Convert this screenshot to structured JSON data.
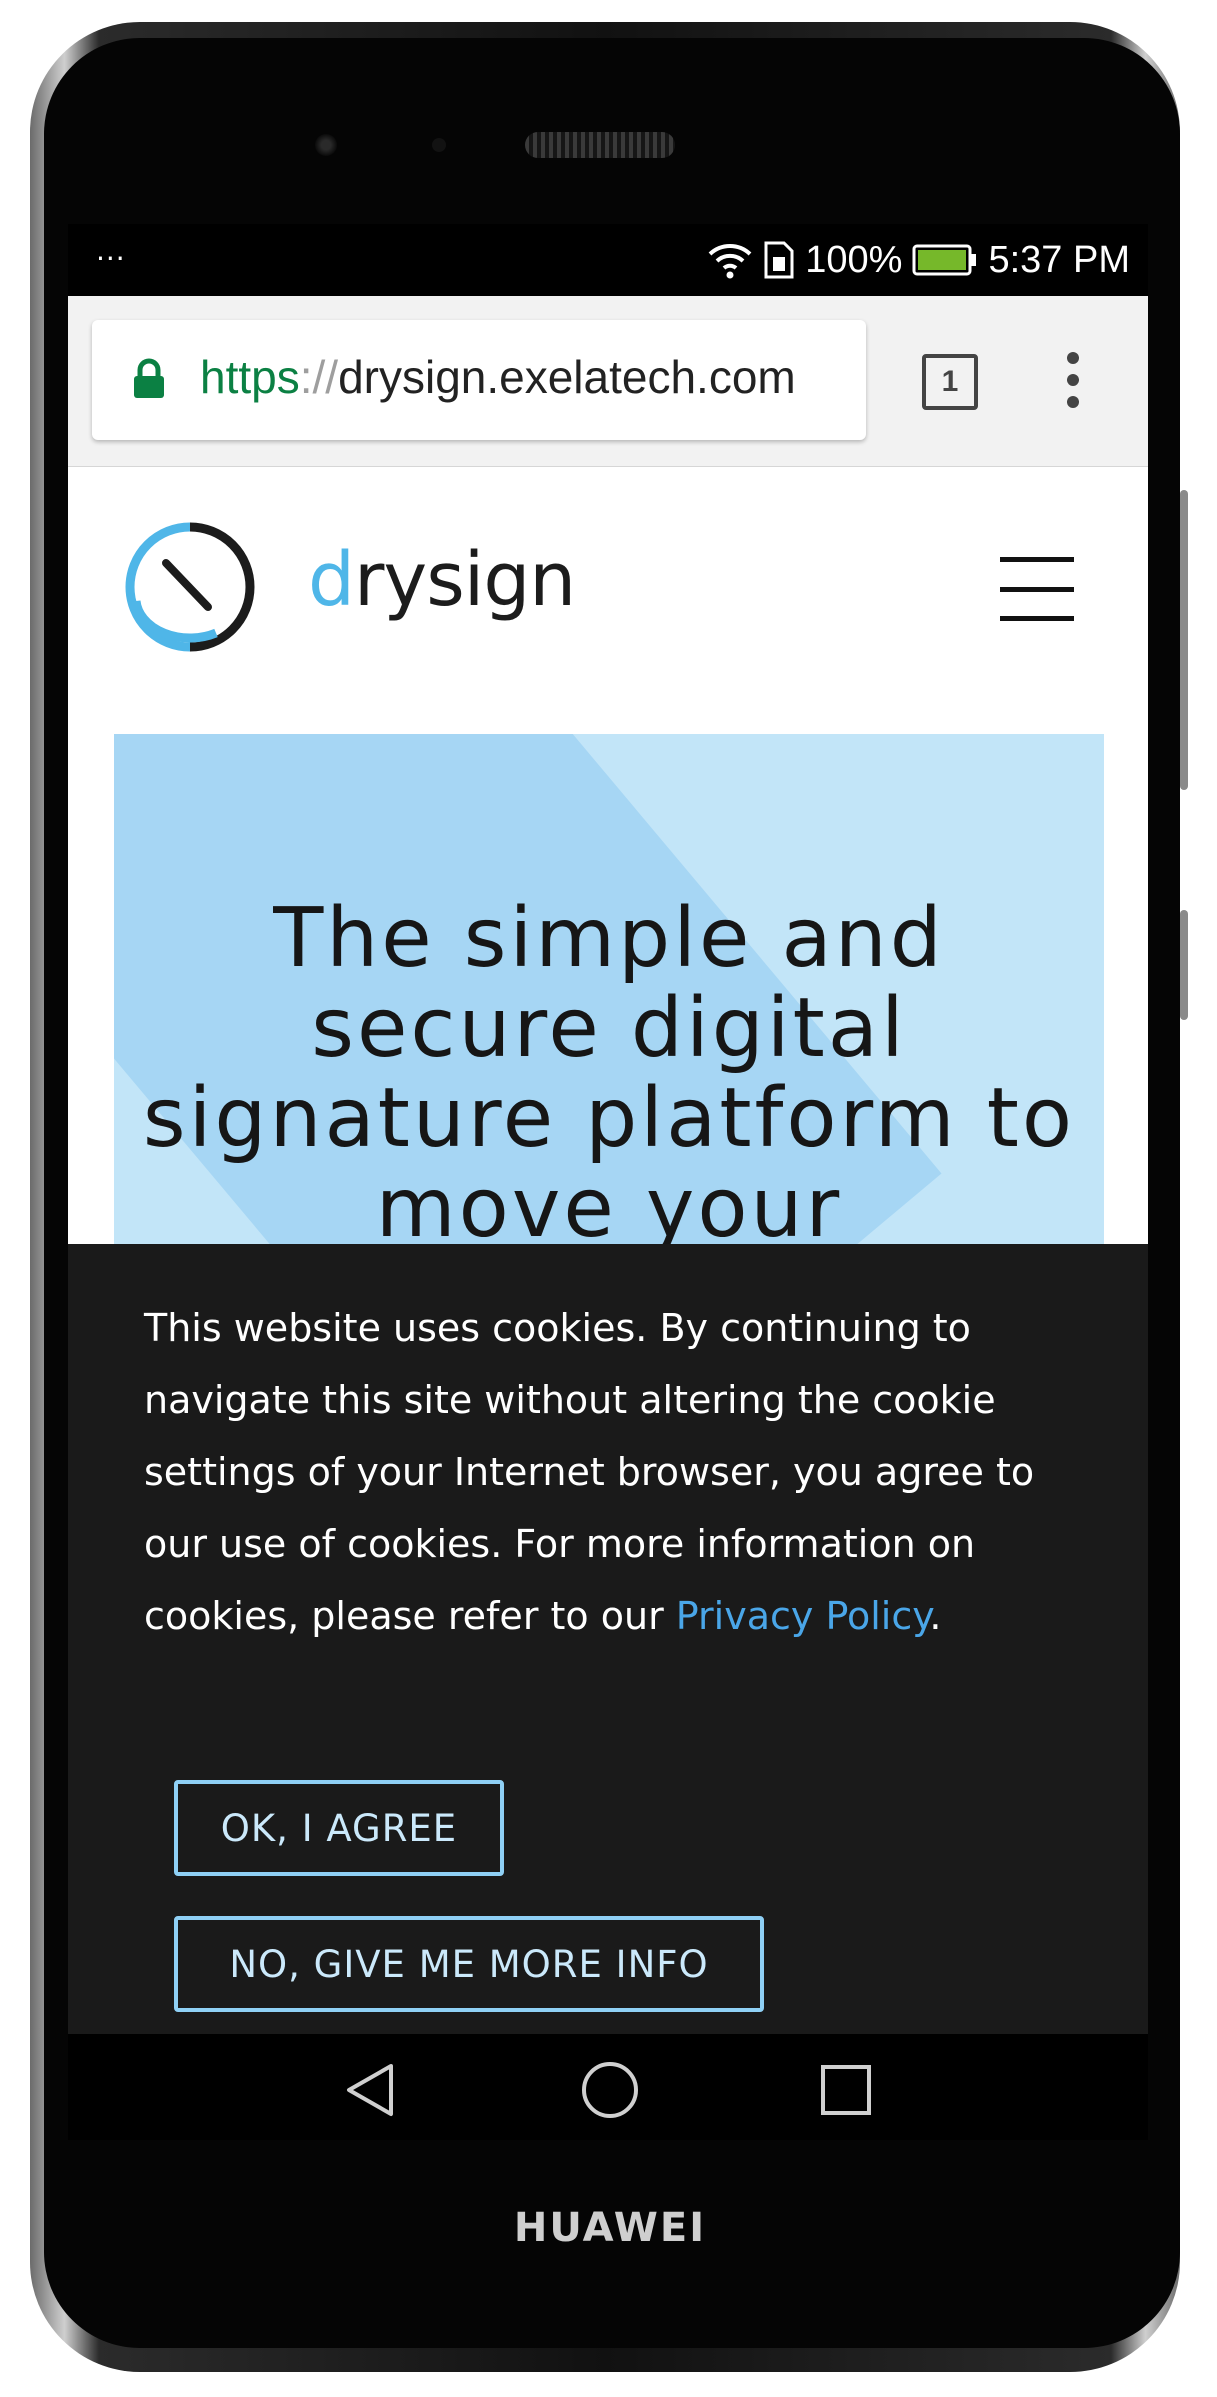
{
  "device": {
    "brand": "HUAWEI"
  },
  "status_bar": {
    "notification_dots": "···",
    "battery_percent": "100%",
    "time": "5:37 PM",
    "battery_color": "#76b82a"
  },
  "browser": {
    "url_scheme": "https",
    "url_separator": "://",
    "url_host": "drysign.exelatech.com",
    "tab_count": "1"
  },
  "site": {
    "logo_text_prefix": "d",
    "logo_text_rest": "rysign",
    "hero_title": "The simple and secure digital signature platform to move your"
  },
  "cookie_banner": {
    "message": "This website uses cookies. By continuing to navigate this site without altering the cookie settings of your Internet browser, you agree to our use of cookies. For more information on cookies, please refer to our ",
    "link_text": "Privacy Policy",
    "message_end": ".",
    "agree_label": "OK, I AGREE",
    "info_label": "NO, GIVE ME MORE INFO"
  },
  "colors": {
    "accent_blue": "#4fb6e8",
    "hero_bg": "#c2e5f8",
    "banner_bg": "#1a1a1a",
    "button_border": "#8fd0f5",
    "secure_green": "#0b8043"
  }
}
